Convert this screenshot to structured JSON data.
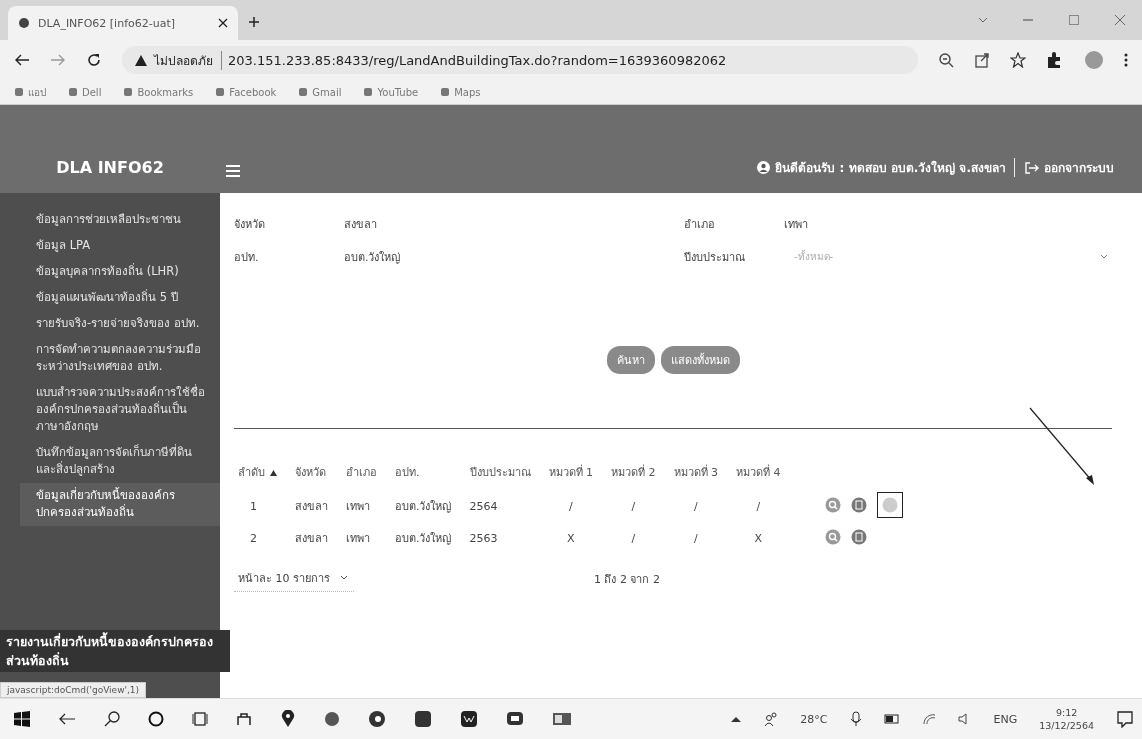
{
  "browser": {
    "tab_title": "DLA_INFO62 [info62-uat]",
    "security_label": "ไม่ปลอดภัย",
    "url": "203.151.233.85:8433/reg/LandAndBuildingTax.do?random=1639360982062",
    "bookmarks": [
      "แอป",
      "Dell",
      "Bookmarks",
      "Facebook",
      "Gmail",
      "YouTube",
      "Maps"
    ]
  },
  "header": {
    "brand": "DLA INFO62",
    "greeting": "ยินดีต้อนรับ : ทดสอบ อบต.วังใหญ่ จ.สงขลา",
    "logout": "ออกจากระบบ"
  },
  "sidebar": {
    "items": [
      {
        "label": "ข้อมูลการช่วยเหลือประชาชน",
        "selected": false
      },
      {
        "label": "ข้อมูล LPA",
        "selected": false
      },
      {
        "label": "ข้อมูลบุคลากรท้องถิ่น (LHR)",
        "selected": false
      },
      {
        "label": "ข้อมูลแผนพัฒนาท้องถิ่น 5 ปี",
        "selected": false
      },
      {
        "label": "รายรับจริง-รายจ่ายจริงของ อปท.",
        "selected": false
      },
      {
        "label": "การจัดทำความตกลงความร่วมมือระหว่างประเทศของ อปท.",
        "selected": false
      },
      {
        "label": "แบบสำรวจความประสงค์การใช้ชื่อองค์กรปกครองส่วนท้องถิ่นเป็นภาษาอังกฤษ",
        "selected": false
      },
      {
        "label": "บันทึกข้อมูลการจัดเก็บภาษีที่ดินและสิ่งปลูกสร้าง",
        "selected": false
      },
      {
        "label": "ข้อมูลเกี่ยวกับหนี้ขององค์กรปกครองส่วนท้องถิ่น",
        "selected": true
      }
    ],
    "tooltip": "รายงานเกี่ยวกับหนี้ขององค์กรปกครองส่วนท้องถิ่น"
  },
  "filters": [
    {
      "kind": "text",
      "label": "จังหวัด",
      "value": "สงขลา"
    },
    {
      "kind": "text",
      "label": "อำเภอ",
      "value": "เทพา"
    },
    {
      "kind": "text",
      "label": "อปท.",
      "value": "อบต.วังใหญ่"
    },
    {
      "kind": "select",
      "label": "ปีงบประมาณ",
      "placeholder": "-ทั้งหมด-"
    }
  ],
  "buttons": [
    "ค้นหา",
    "แสดงทั้งหมด"
  ],
  "table": {
    "columns": [
      {
        "label": "ลำดับ",
        "sorted": true
      },
      {
        "label": "จังหวัด",
        "sorted": false
      },
      {
        "label": "อำเภอ",
        "sorted": false
      },
      {
        "label": "อปท.",
        "sorted": false
      },
      {
        "label": "ปีงบประมาณ",
        "sorted": false
      },
      {
        "label": "หมวดที่ 1",
        "sorted": false
      },
      {
        "label": "หมวดที่ 2",
        "sorted": false
      },
      {
        "label": "หมวดที่ 3",
        "sorted": false
      },
      {
        "label": "หมวดที่ 4",
        "sorted": false
      }
    ],
    "rows": [
      {
        "cells": [
          "1",
          "สงขลา",
          "เทพา",
          "อบต.วังใหญ่",
          "2564",
          "/",
          "/",
          "/",
          "/"
        ],
        "actions": [
          {
            "kind": "view"
          },
          {
            "kind": "edit"
          },
          {
            "kind": "delete"
          }
        ]
      },
      {
        "cells": [
          "2",
          "สงขลา",
          "เทพา",
          "อบต.วังใหญ่",
          "2563",
          "X",
          "/",
          "/",
          "X"
        ],
        "actions": [
          {
            "kind": "view"
          },
          {
            "kind": "edit"
          }
        ]
      }
    ]
  },
  "pager": {
    "page_size": "หน้าละ 10 รายการ",
    "summary": "1 ถึง 2 จาก 2"
  },
  "status_bar": "javascript:doCmd('goView',1)",
  "taskbar": {
    "weather": "28°C",
    "language": "ENG",
    "time": "9:12",
    "date": "13/12/2564"
  }
}
